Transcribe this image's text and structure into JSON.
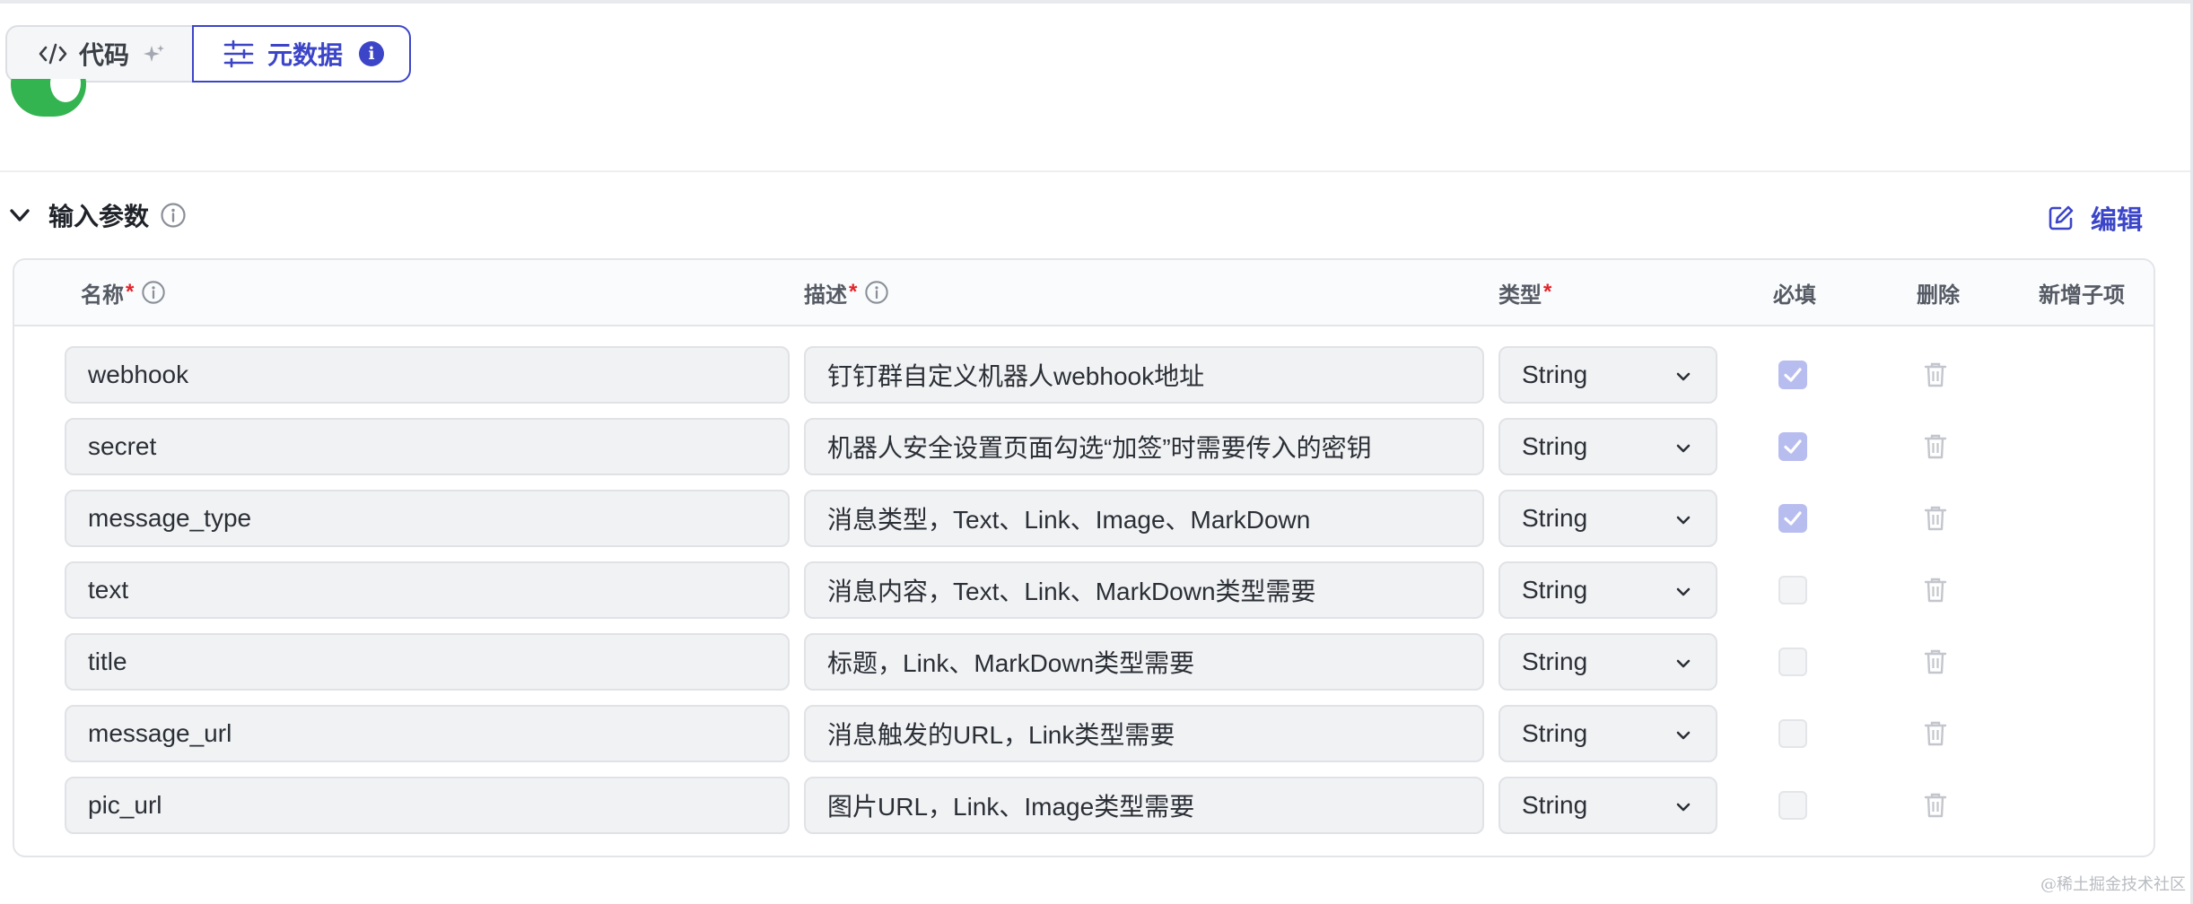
{
  "tabs": {
    "code_label": "代码",
    "meta_label": "元数据",
    "meta_badge": "i"
  },
  "toggle": {
    "state": "on",
    "color": "#33b451"
  },
  "section": {
    "title": "输入参数",
    "edit_label": "编辑",
    "accent_color": "#3c45c8"
  },
  "table": {
    "headers": {
      "name": "名称",
      "desc": "描述",
      "type": "类型",
      "required": "必填",
      "delete": "删除",
      "add_child": "新增子项"
    },
    "required_mark": "*",
    "rows": [
      {
        "name": "webhook",
        "desc": "钉钉群自定义机器人webhook地址",
        "type": "String",
        "required": true
      },
      {
        "name": "secret",
        "desc": "机器人安全设置页面勾选“加签”时需要传入的密钥",
        "type": "String",
        "required": true
      },
      {
        "name": "message_type",
        "desc": "消息类型，Text、Link、Image、MarkDown",
        "type": "String",
        "required": true
      },
      {
        "name": "text",
        "desc": "消息内容，Text、Link、MarkDown类型需要",
        "type": "String",
        "required": false
      },
      {
        "name": "title",
        "desc": "标题，Link、MarkDown类型需要",
        "type": "String",
        "required": false
      },
      {
        "name": "message_url",
        "desc": "消息触发的URL，Link类型需要",
        "type": "String",
        "required": false
      },
      {
        "name": "pic_url",
        "desc": "图片URL，Link、Image类型需要",
        "type": "String",
        "required": false
      }
    ]
  },
  "watermark": "@稀土掘金技术社区"
}
